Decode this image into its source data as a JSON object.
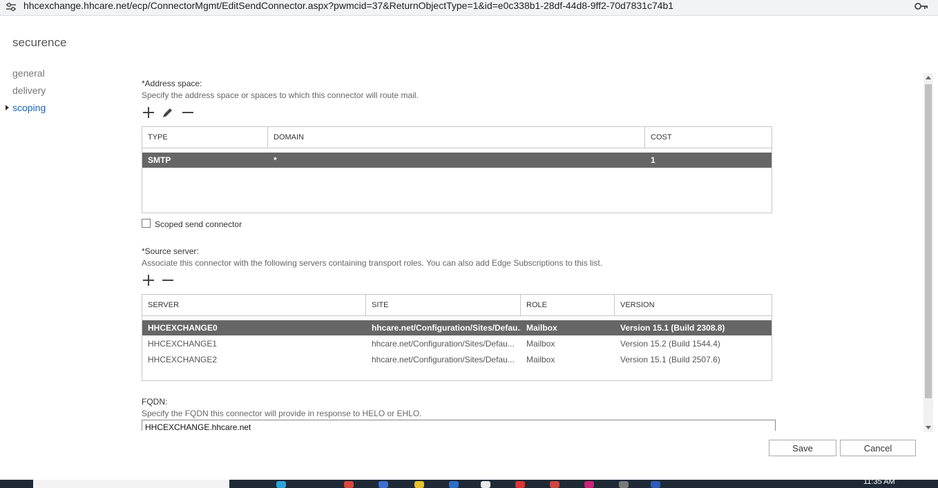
{
  "browser": {
    "url": "hhcexchange.hhcare.net/ecp/ConnectorMgmt/EditSendConnector.aspx?pwmcid=37&ReturnObjectType=1&id=e0c338b1-28df-44d8-9ff2-70d7831c74b1"
  },
  "page": {
    "title": "securence"
  },
  "nav": {
    "items": [
      {
        "label": "general"
      },
      {
        "label": "delivery"
      },
      {
        "label": "scoping"
      }
    ]
  },
  "address_space": {
    "label": "*Address space:",
    "hint": "Specify the address space or spaces to which this connector will route mail.",
    "columns": [
      "TYPE",
      "DOMAIN",
      "COST"
    ],
    "rows": [
      {
        "type": "SMTP",
        "domain": "*",
        "cost": "1",
        "selected": true
      }
    ]
  },
  "scoped": {
    "label": "Scoped send connector",
    "checked": false
  },
  "source_server": {
    "label": "*Source server:",
    "hint": "Associate this connector with the following servers containing transport roles. You can also add Edge Subscriptions to this list.",
    "columns": [
      "SERVER",
      "SITE",
      "ROLE",
      "VERSION"
    ],
    "rows": [
      {
        "server": "HHCEXCHANGE0",
        "site": "hhcare.net/Configuration/Sites/Defau...",
        "role": "Mailbox",
        "version": "Version 15.1 (Build 2308.8)",
        "selected": true
      },
      {
        "server": "HHCEXCHANGE1",
        "site": "hhcare.net/Configuration/Sites/Defau...",
        "role": "Mailbox",
        "version": "Version 15.2 (Build 1544.4)",
        "selected": false
      },
      {
        "server": "HHCEXCHANGE2",
        "site": "hhcare.net/Configuration/Sites/Defau...",
        "role": "Mailbox",
        "version": "Version 15.1 (Build 2507.6)",
        "selected": false
      }
    ]
  },
  "fqdn": {
    "label": "FQDN:",
    "hint": "Specify the FQDN this connector will provide in response to HELO or EHLO.",
    "value": "HHCEXCHANGE.hhcare.net"
  },
  "buttons": {
    "save": "Save",
    "cancel": "Cancel"
  },
  "taskbar": {
    "time": "11:35 AM"
  }
}
